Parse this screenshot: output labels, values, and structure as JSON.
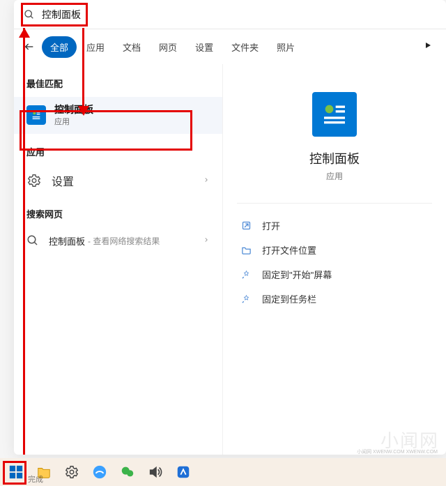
{
  "search": {
    "value": "控制面板",
    "placeholder": ""
  },
  "tabs": {
    "items": [
      "全部",
      "应用",
      "文档",
      "网页",
      "设置",
      "文件夹",
      "照片"
    ],
    "active_index": 0
  },
  "left": {
    "best_match_header": "最佳匹配",
    "best": {
      "title": "控制面板",
      "subtitle": "应用"
    },
    "apps_header": "应用",
    "settings_label": "设置",
    "web_header": "搜索网页",
    "web_item": {
      "title": "控制面板",
      "subtitle": " - 查看网络搜索结果"
    }
  },
  "right": {
    "title": "控制面板",
    "subtitle": "应用",
    "actions": [
      "打开",
      "打开文件位置",
      "固定到\"开始\"屏幕",
      "固定到任务栏"
    ]
  },
  "taskbar": {
    "done": "完成"
  },
  "watermark": {
    "big": "小闻网",
    "tiny": "小闻网 XWENW.COM XWENW.COM"
  }
}
